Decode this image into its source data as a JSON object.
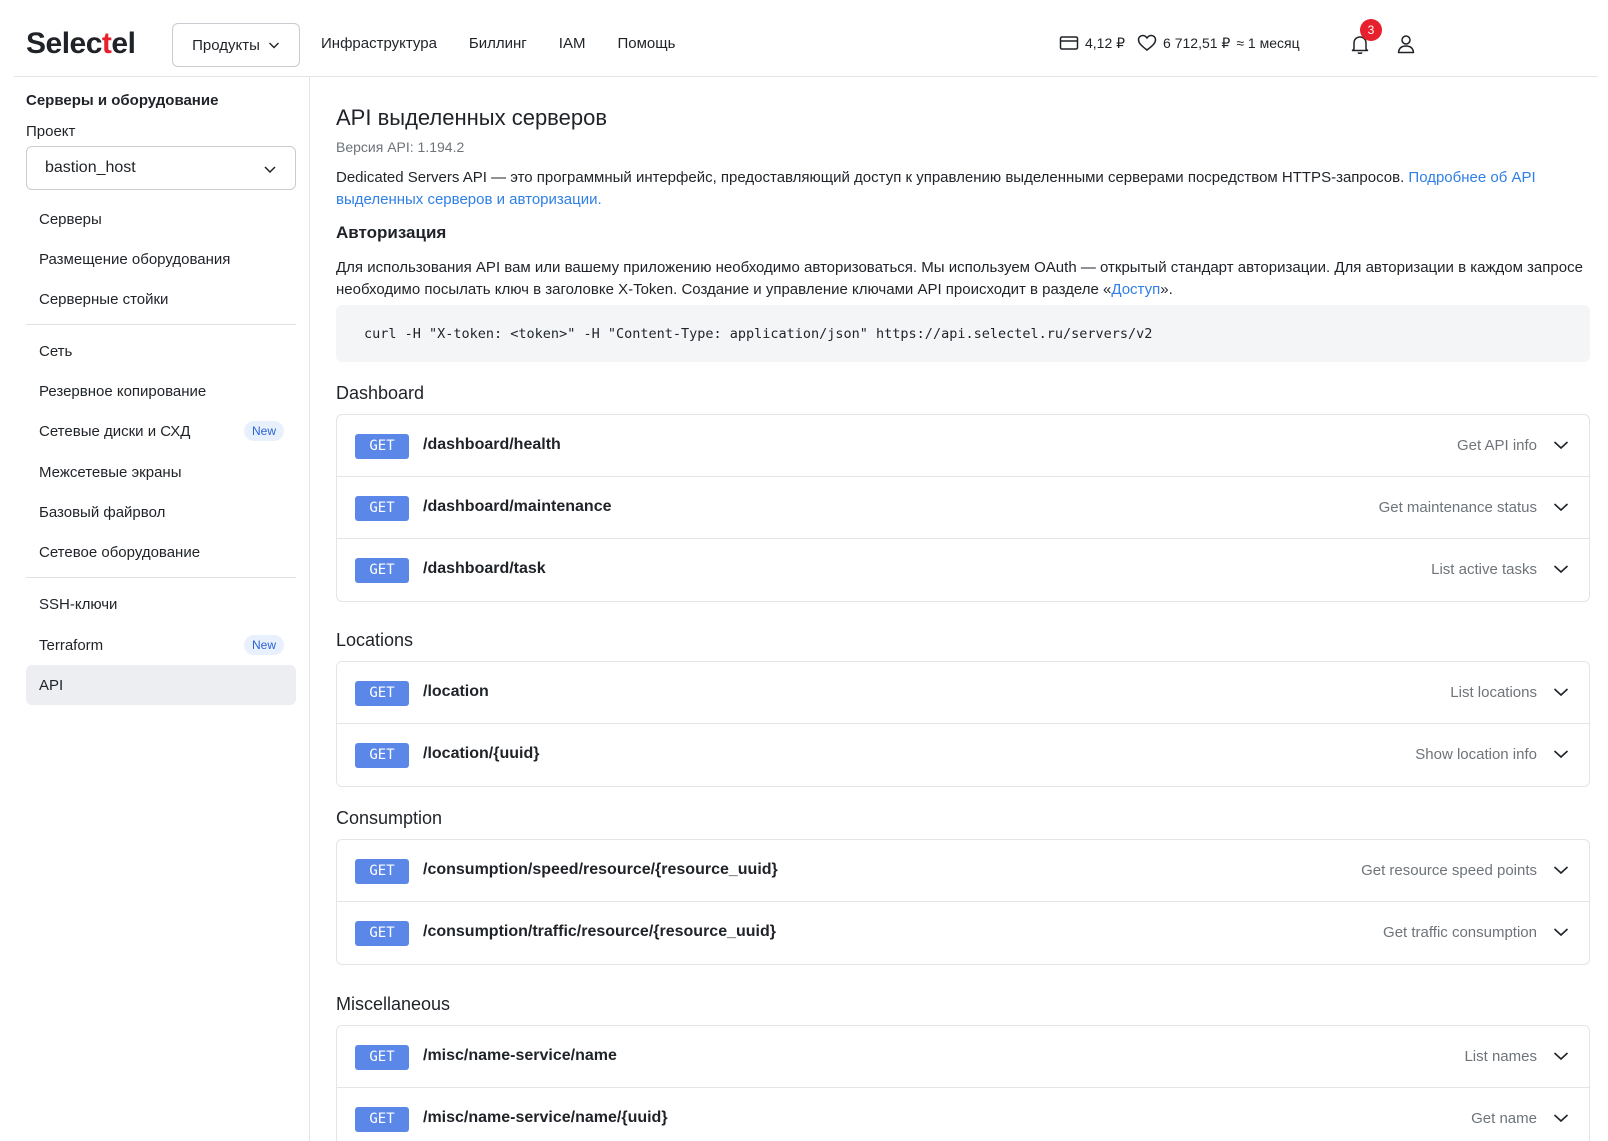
{
  "header": {
    "logo_prefix": "Selec",
    "logo_accent": "t",
    "logo_suffix": "el",
    "products_label": "Продукты",
    "nav": [
      "Инфраструктура",
      "Биллинг",
      "IAM",
      "Помощь"
    ],
    "balance_value": "4,12 ₽",
    "bonus_value": "6 712,51 ₽",
    "period": "≈ 1 месяц",
    "notifications_count": "3",
    "accent_color": "#e6202c"
  },
  "sidebar": {
    "title": "Серверы и оборудование",
    "project_label": "Проект",
    "project_value": "bastion_host",
    "items": [
      {
        "label": "Серверы"
      },
      {
        "label": "Размещение оборудования"
      },
      {
        "label": "Серверные стойки"
      },
      {
        "label": "Сеть"
      },
      {
        "label": "Резервное копирование"
      },
      {
        "label": "Сетевые диски и СХД",
        "badge": "New"
      },
      {
        "label": "Межсетевые экраны"
      },
      {
        "label": "Базовый файрвол"
      },
      {
        "label": "Сетевое оборудование"
      },
      {
        "label": "SSH-ключи"
      },
      {
        "label": "Terraform",
        "badge": "New"
      },
      {
        "label": "API",
        "active": true
      }
    ]
  },
  "main": {
    "title": "API выделенных серверов",
    "version": "Версия API: 1.194.2",
    "description": "Dedicated Servers API — это программный интерфейс, предоставляющий доступ к управлению выделенными серверами посредством HTTPS-запросов. ",
    "description_link": "Подробнее об API выделенных серверов и авторизации.",
    "auth_heading": "Авторизация",
    "auth_text_before": "Для использования API вам или вашему приложению необходимо авторизоваться. Мы используем OAuth — открытый стандарт авторизации. Для авторизации в каждом запросе необходимо посылать ключ в заголовке X-Token. Создание и управление ключами API происходит в разделе «",
    "auth_link": "Доступ",
    "auth_text_after": "».",
    "code": "curl -H \"X-token: <token>\" -H \"Content-Type: application/json\" https://api.selectel.ru/servers/v2",
    "sections": [
      {
        "title": "Dashboard",
        "endpoints": [
          {
            "method": "GET",
            "path": "/dashboard/health",
            "summary": "Get API info"
          },
          {
            "method": "GET",
            "path": "/dashboard/maintenance",
            "summary": "Get maintenance status"
          },
          {
            "method": "GET",
            "path": "/dashboard/task",
            "summary": "List active tasks"
          }
        ]
      },
      {
        "title": "Locations",
        "endpoints": [
          {
            "method": "GET",
            "path": "/location",
            "summary": "List locations"
          },
          {
            "method": "GET",
            "path": "/location/{uuid}",
            "summary": "Show location info"
          }
        ]
      },
      {
        "title": "Consumption",
        "endpoints": [
          {
            "method": "GET",
            "path": "/consumption/speed/resource/{resource_uuid}",
            "summary": "Get resource speed points"
          },
          {
            "method": "GET",
            "path": "/consumption/traffic/resource/{resource_uuid}",
            "summary": "Get traffic consumption"
          }
        ]
      },
      {
        "title": "Miscellaneous",
        "endpoints": [
          {
            "method": "GET",
            "path": "/misc/name-service/name",
            "summary": "List names"
          },
          {
            "method": "GET",
            "path": "/misc/name-service/name/{uuid}",
            "summary": "Get name"
          }
        ]
      }
    ],
    "method_color": "#5a87e8",
    "link_color": "#2f7fe6"
  }
}
